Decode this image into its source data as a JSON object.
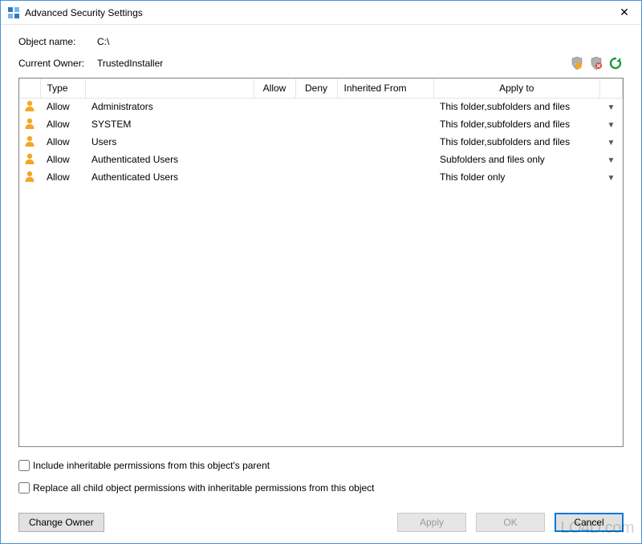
{
  "window": {
    "title": "Advanced Security Settings"
  },
  "object": {
    "label": "Object name:",
    "value": "C:\\"
  },
  "owner": {
    "label": "Current Owner:",
    "value": "TrustedInstaller"
  },
  "columns": {
    "type": "Type",
    "allow": "Allow",
    "deny": "Deny",
    "inherited": "Inherited From",
    "apply": "Apply to"
  },
  "rows": [
    {
      "type": "Allow",
      "principal": "Administrators",
      "allow": "",
      "deny": "",
      "inherited": "",
      "apply": "This folder,subfolders and files"
    },
    {
      "type": "Allow",
      "principal": "SYSTEM",
      "allow": "",
      "deny": "",
      "inherited": "",
      "apply": "This folder,subfolders and files"
    },
    {
      "type": "Allow",
      "principal": "Users",
      "allow": "",
      "deny": "",
      "inherited": "",
      "apply": "This folder,subfolders and files"
    },
    {
      "type": "Allow",
      "principal": "Authenticated Users",
      "allow": "",
      "deny": "",
      "inherited": "",
      "apply": "Subfolders and files only"
    },
    {
      "type": "Allow",
      "principal": "Authenticated Users",
      "allow": "",
      "deny": "",
      "inherited": "",
      "apply": "This folder only"
    }
  ],
  "checkboxes": {
    "inherit": "Include inheritable permissions from this object's parent",
    "replace": "Replace all child object permissions with inheritable permissions from this object"
  },
  "buttons": {
    "change_owner": "Change Owner",
    "apply": "Apply",
    "ok": "OK",
    "cancel": "Cancel"
  },
  "watermark": "LO4D.com"
}
